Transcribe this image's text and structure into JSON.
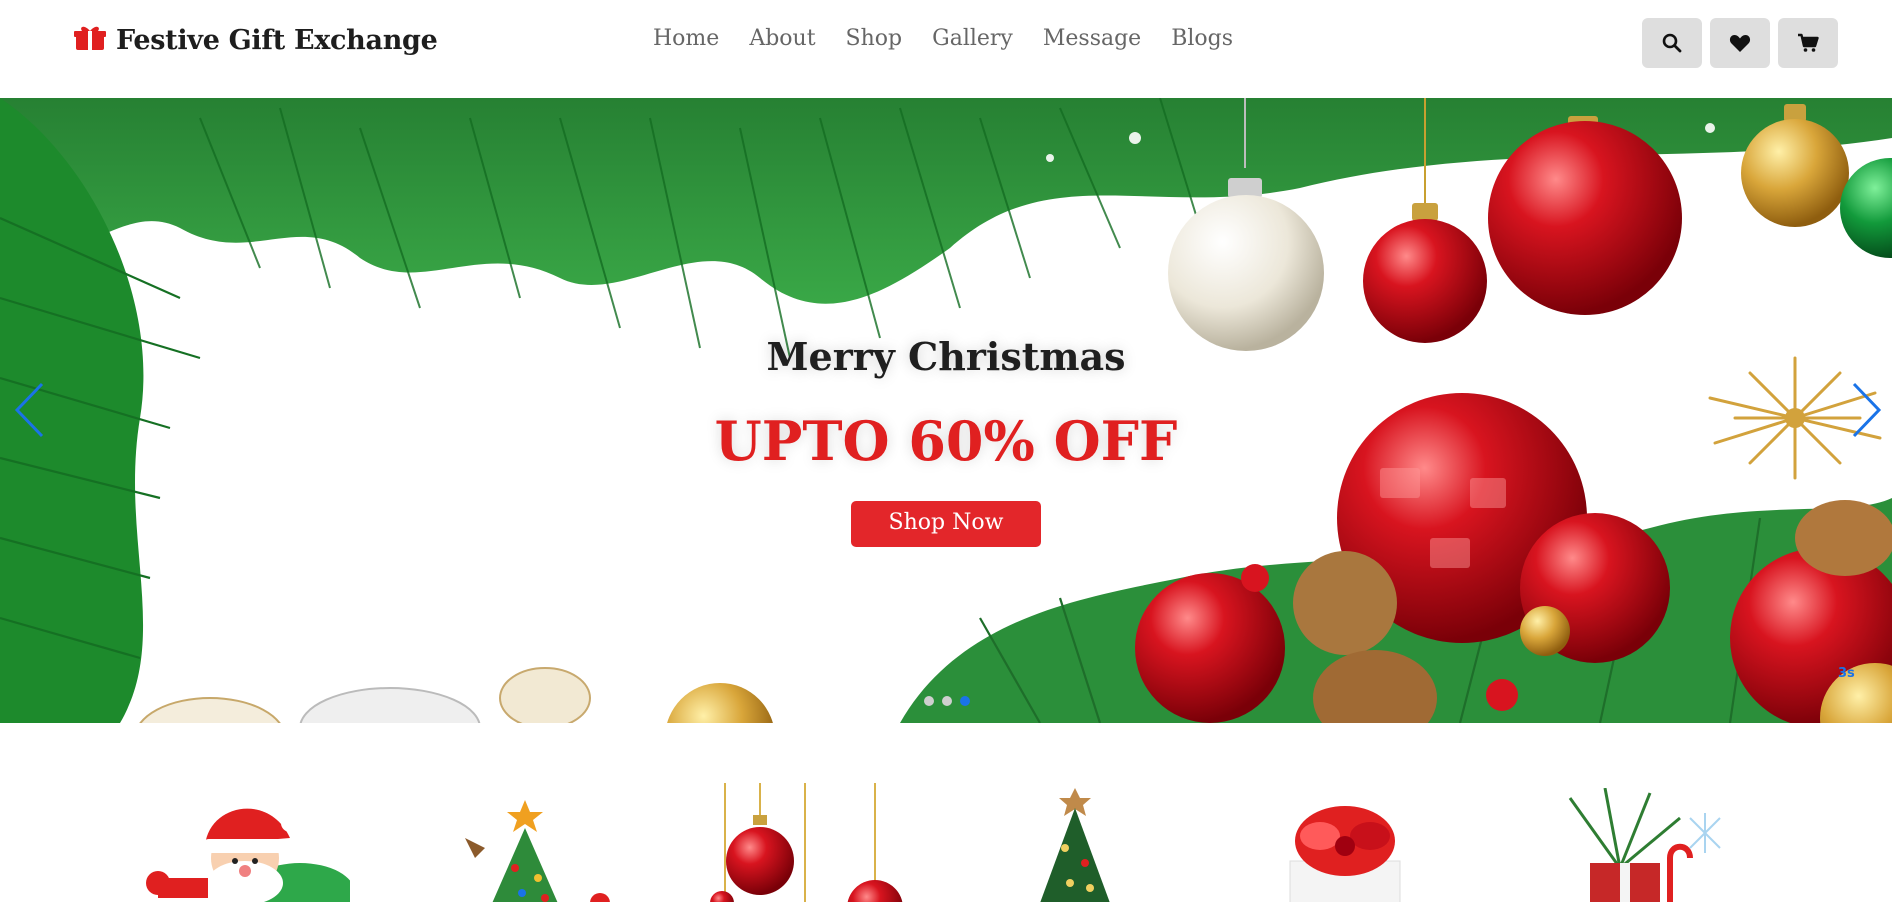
{
  "brand": {
    "name": "Festive Gift Exchange",
    "icon": "gift-icon",
    "color": "#e02020"
  },
  "nav": {
    "items": [
      "Home",
      "About",
      "Shop",
      "Gallery",
      "Message",
      "Blogs"
    ]
  },
  "actions": {
    "search_icon": "search-icon",
    "wishlist_icon": "heart-icon",
    "cart_icon": "cart-icon"
  },
  "hero": {
    "title": "Merry Christmas",
    "promo": "UPTO 60% OFF",
    "cta_label": "Shop Now",
    "accent": "#e3262a",
    "slide_count": 3,
    "active_slide": 3,
    "slide_badge": "3s"
  },
  "categories": {
    "icons": [
      "santa-icon",
      "christmas-tree-icon",
      "ornaments-icon",
      "small-tree-icon",
      "gift-bow-icon",
      "gift-pine-icon"
    ]
  }
}
